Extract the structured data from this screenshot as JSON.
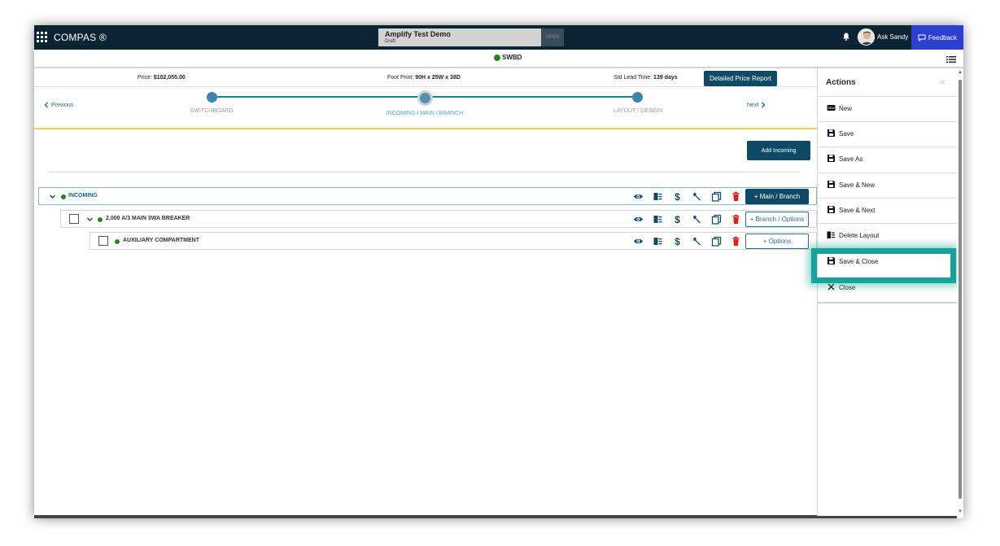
{
  "app": {
    "brand": "COMPAS ®"
  },
  "document": {
    "title": "Amplify Test Demo",
    "status": "Draft",
    "badge": "OPEN"
  },
  "user": {
    "name": "Ask Sandy"
  },
  "feedback": {
    "label": "Feedback"
  },
  "product": {
    "label": "SWBD"
  },
  "summary": {
    "price_label": "Price:",
    "price_value": "$102,055.00",
    "footprint_label": "Foot Print:",
    "footprint_value": "90H x 25W x 38D",
    "lead_label": "Std Lead Time:",
    "lead_value": "139 days",
    "report_button": "Detailed Price Report"
  },
  "stepper": {
    "previous": "Previous",
    "next": "Next",
    "steps": [
      {
        "label": "SWITCHBOARD"
      },
      {
        "label": "INCOMING / MAIN / BRANCH"
      },
      {
        "label": "LAYOUT / DESIGN"
      }
    ]
  },
  "add_incoming": "Add Incoming",
  "tree": [
    {
      "label": "INCOMING",
      "button": "+ Main / Branch"
    },
    {
      "label": "2,000 A/3 MAIN 3WA BREAKER",
      "button": "+ Branch / Options"
    },
    {
      "label": "AUXILIARY COMPARTMENT",
      "button": "+ Options"
    }
  ],
  "actions_panel": {
    "title": "Actions",
    "close": "×",
    "items": [
      {
        "label": "New",
        "icon": "new-icon"
      },
      {
        "label": "Save",
        "icon": "save-icon"
      },
      {
        "label": "Save As",
        "icon": "save-icon"
      },
      {
        "label": "Save & New",
        "icon": "save-icon"
      },
      {
        "label": "Save & Next",
        "icon": "save-icon"
      },
      {
        "label": "Delete Layout",
        "icon": "delete-layout-icon"
      },
      {
        "label": "Save & Close",
        "icon": "save-icon"
      },
      {
        "label": "Close",
        "icon": "close-icon"
      }
    ]
  },
  "colors": {
    "topbar": "#0b2434",
    "primary": "#0e4a66",
    "feedback": "#2c3fd0",
    "status_green": "#1a8a1a",
    "highlight": "#16a39a",
    "delete_red": "#e02020"
  }
}
